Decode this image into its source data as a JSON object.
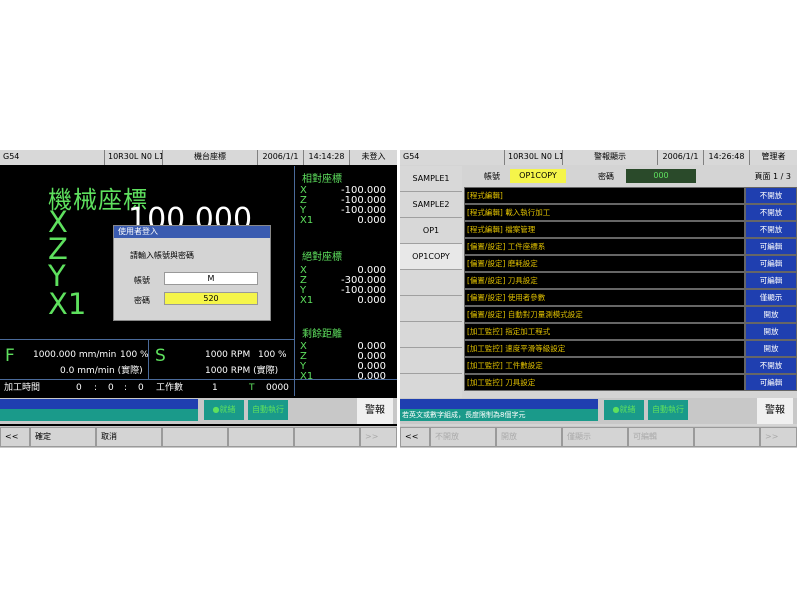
{
  "left_screen": {
    "status": {
      "gcode": "G54",
      "program": "10R30L N0 L1",
      "mode": "機台座標",
      "date": "2006/1/1",
      "time": "14:14:28",
      "login_state": "未登入"
    },
    "main_title": "機械座標",
    "main_axes": [
      "X",
      "Z",
      "Y",
      "X1"
    ],
    "main_value": "100.000",
    "relative": {
      "title": "相對座標",
      "rows": [
        {
          "axis": "X",
          "value": "-100.000"
        },
        {
          "axis": "Z",
          "value": "-100.000"
        },
        {
          "axis": "Y",
          "value": "-100.000"
        },
        {
          "axis": "X1",
          "value": "0.000"
        }
      ]
    },
    "absolute": {
      "title": "絕對座標",
      "rows": [
        {
          "axis": "X",
          "value": "0.000"
        },
        {
          "axis": "Z",
          "value": "-300.000"
        },
        {
          "axis": "Y",
          "value": "-100.000"
        },
        {
          "axis": "X1",
          "value": "0.000"
        }
      ]
    },
    "remaining": {
      "title": "剩餘距離",
      "rows": [
        {
          "axis": "X",
          "value": "0.000"
        },
        {
          "axis": "Z",
          "value": "0.000"
        },
        {
          "axis": "Y",
          "value": "0.000"
        },
        {
          "axis": "X1",
          "value": "0.000"
        }
      ]
    },
    "dialog": {
      "title": "使用者登入",
      "prompt": "請輸入帳號與密碼",
      "account_label": "帳號",
      "account_value": "M",
      "password_label": "密碼",
      "password_value": "520"
    },
    "feed": {
      "letter": "F",
      "rate": "1000.000",
      "rate_unit": "mm/min",
      "override": "100 %",
      "actual": "0.0",
      "actual_unit": "mm/min",
      "actual_label": "(實際)"
    },
    "spindle": {
      "letter": "S",
      "rpm": "1000",
      "rpm_unit": "RPM",
      "override": "100 %",
      "actual": "1000",
      "actual_unit": "RPM",
      "actual_label": "(實際)"
    },
    "time_bar": {
      "label": "加工時間",
      "h": "0",
      "sep1": ":",
      "m": "0",
      "sep2": ":",
      "s": "0",
      "work_label": "工作數",
      "work_count": "1",
      "tool_label": "T",
      "tool_value": "0000"
    },
    "strip": {
      "ready": "●就緒",
      "auto": "自動執行",
      "alarm": "警報"
    },
    "softkeys": [
      "<<",
      "確定",
      "取消",
      "",
      "",
      "",
      ">>"
    ]
  },
  "right_screen": {
    "status": {
      "gcode": "G54",
      "program": "10R30L N0 L1",
      "mode": "警報顯示",
      "date": "2006/1/1",
      "time": "14:26:48",
      "login_state": "管理者"
    },
    "programs": [
      "SAMPLE1",
      "SAMPLE2",
      "OP1",
      "OP1COPY",
      "",
      "",
      "",
      "",
      ""
    ],
    "selected_program_index": 3,
    "header": {
      "account_label": "帳號",
      "account_value": "OP1COPY",
      "password_label": "密碼",
      "password_value": "000",
      "page": "頁面 1 / 3"
    },
    "permissions": [
      {
        "name": "[程式編輯]",
        "state": "不開放"
      },
      {
        "name": "[程式編輯] 載入執行加工",
        "state": "不開放"
      },
      {
        "name": "[程式編輯] 檔案管理",
        "state": "不開放"
      },
      {
        "name": "[偏置/設定] 工件座標系",
        "state": "可編輯"
      },
      {
        "name": "[偏置/設定] 磨耗設定",
        "state": "可編輯"
      },
      {
        "name": "[偏置/設定] 刀具設定",
        "state": "可編輯"
      },
      {
        "name": "[偏置/設定] 使用者參數",
        "state": "僅顯示"
      },
      {
        "name": "[偏置/設定] 自動對刀量測模式設定",
        "state": "開放"
      },
      {
        "name": "[加工監控] 指定加工程式",
        "state": "開放"
      },
      {
        "name": "[加工監控] 速度平滑等級設定",
        "state": "開放"
      },
      {
        "name": "[加工監控] 工件數設定",
        "state": "不開放"
      },
      {
        "name": "[加工監控] 刀具設定",
        "state": "可編輯"
      }
    ],
    "strip": {
      "message": "若英文或數字組成，長度限制為8個字元",
      "ready": "●就緒",
      "auto": "自動執行",
      "alarm": "警報"
    },
    "softkeys": [
      "<<",
      "不開放",
      "開放",
      "僅顯示",
      "可編輯",
      "",
      ">>"
    ]
  },
  "colors": {
    "screen_bg": "#000000",
    "accent_green": "#5ee05e",
    "panel_blue": "#1f3fb0",
    "teal": "#1a9a8a",
    "highlight_yellow": "#f5f54a",
    "text_yellow": "#e0c000"
  }
}
